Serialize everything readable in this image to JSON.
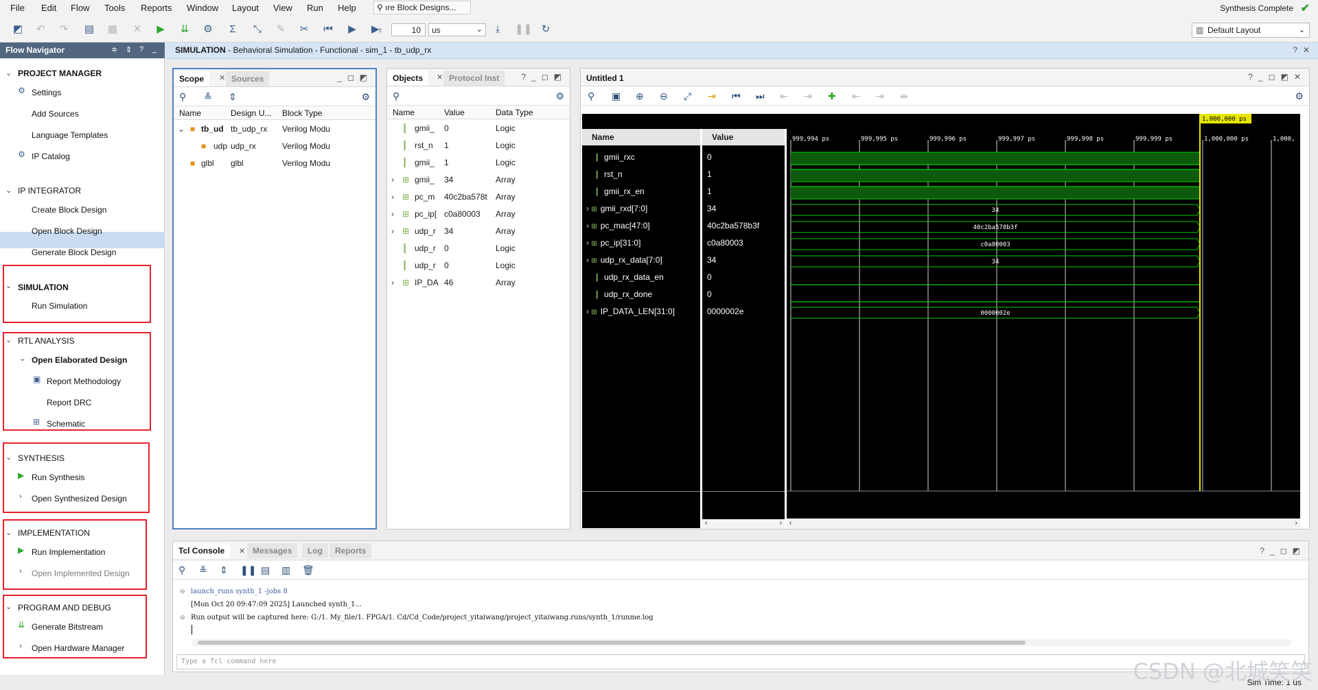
{
  "menu": [
    "File",
    "Edit",
    "Flow",
    "Tools",
    "Reports",
    "Window",
    "Layout",
    "View",
    "Run",
    "Help"
  ],
  "quick_search": "ıre Block Designs...",
  "status": {
    "synthesis": "Synthesis Complete"
  },
  "toolbar": {
    "time_value": "10",
    "time_unit": "us",
    "layout": "Default Layout"
  },
  "flow_nav": {
    "title": "Flow Navigator",
    "sections": {
      "project_manager": "PROJECT MANAGER",
      "ip_integrator": "IP INTEGRATOR",
      "simulation": "SIMULATION",
      "rtl_analysis": "RTL ANALYSIS",
      "synthesis": "SYNTHESIS",
      "implementation": "IMPLEMENTATION",
      "program_debug": "PROGRAM AND DEBUG"
    },
    "items": {
      "settings": "Settings",
      "add_sources": "Add Sources",
      "language_templates": "Language Templates",
      "ip_catalog": "IP Catalog",
      "create_block_design": "Create Block Design",
      "open_block_design": "Open Block Design",
      "generate_block_design": "Generate Block Design",
      "run_simulation": "Run Simulation",
      "open_elaborated_design": "Open Elaborated Design",
      "report_methodology": "Report Methodology",
      "report_drc": "Report DRC",
      "schematic": "Schematic",
      "run_synthesis": "Run Synthesis",
      "open_synthesized_design": "Open Synthesized Design",
      "run_implementation": "Run Implementation",
      "open_implemented_design": "Open Implemented Design",
      "generate_bitstream": "Generate Bitstream",
      "open_hardware_manager": "Open Hardware Manager"
    }
  },
  "sim_header": {
    "prefix": "SIMULATION",
    "rest": " - Behavioral Simulation - Functional - sim_1 - tb_udp_rx"
  },
  "scope_panel": {
    "tabs": [
      "Scope",
      "Sources"
    ],
    "columns": [
      "Name",
      "Design U...",
      "Block Type"
    ],
    "rows": [
      {
        "name": "tb_ud",
        "design": "tb_udp_rx",
        "type": "Verilog Modu"
      },
      {
        "name": "udp",
        "design": "udp_rx",
        "type": "Verilog Modu"
      },
      {
        "name": "glbl",
        "design": "glbl",
        "type": "Verilog Modu"
      }
    ]
  },
  "objects_panel": {
    "tabs": [
      "Objects",
      "Protocol Inst"
    ],
    "columns": [
      "Name",
      "Value",
      "Data Type"
    ],
    "rows": [
      {
        "name": "gmii_",
        "value": "0",
        "type": "Logic"
      },
      {
        "name": "rst_n",
        "value": "1",
        "type": "Logic"
      },
      {
        "name": "gmii_",
        "value": "1",
        "type": "Logic"
      },
      {
        "name": "gmii_",
        "value": "34",
        "type": "Array"
      },
      {
        "name": "pc_m",
        "value": "40c2ba578t",
        "type": "Array"
      },
      {
        "name": "pc_ip[",
        "value": "c0a80003",
        "type": "Array"
      },
      {
        "name": "udp_r",
        "value": "34",
        "type": "Array"
      },
      {
        "name": "udp_r",
        "value": "0",
        "type": "Logic"
      },
      {
        "name": "udp_r",
        "value": "0",
        "type": "Logic"
      },
      {
        "name": "IP_DA",
        "value": "46",
        "type": "Array"
      }
    ]
  },
  "wave": {
    "title": "Untitled 1",
    "name_header": "Name",
    "value_header": "Value",
    "cursor_label": "1,000,000 ps",
    "time_labels": [
      "999,994 ps",
      "999,995 ps",
      "999,996 ps",
      "999,997 ps",
      "999,998 ps",
      "999,999 ps",
      "1,000,000 ps",
      "1,000,"
    ],
    "signals": [
      {
        "name": "gmii_rxc",
        "value": "0",
        "kind": "bit",
        "level": 0,
        "bus_label": ""
      },
      {
        "name": "rst_n",
        "value": "1",
        "kind": "bit",
        "level": 1,
        "bus_label": ""
      },
      {
        "name": "gmii_rx_en",
        "value": "1",
        "kind": "bit",
        "level": 1,
        "bus_label": ""
      },
      {
        "name": "gmii_rxd[7:0]",
        "value": "34",
        "kind": "bus",
        "level": null,
        "bus_label": "34"
      },
      {
        "name": "pc_mac[47:0]",
        "value": "40c2ba578b3f",
        "kind": "bus",
        "level": null,
        "bus_label": "40c2ba578b3f"
      },
      {
        "name": "pc_ip[31:0]",
        "value": "c0a80003",
        "kind": "bus",
        "level": null,
        "bus_label": "c0a80003"
      },
      {
        "name": "udp_rx_data[7:0]",
        "value": "34",
        "kind": "bus",
        "level": null,
        "bus_label": "34"
      },
      {
        "name": "udp_rx_data_en",
        "value": "0",
        "kind": "bit",
        "level": 0,
        "bus_label": ""
      },
      {
        "name": "udp_rx_done",
        "value": "0",
        "kind": "bit",
        "level": 0,
        "bus_label": ""
      },
      {
        "name": "IP_DATA_LEN[31:0]",
        "value": "0000002e",
        "kind": "bus",
        "level": null,
        "bus_label": "0000002e"
      }
    ]
  },
  "console": {
    "tabs": [
      "Tcl Console",
      "Messages",
      "Log",
      "Reports"
    ],
    "lines": [
      "launch_runs synth_1 -jobs 8",
      "[Mon Oct 20 09:47:09 2025] Launched synth_1...",
      "Run output will be captured here: G:/1. My_file/1. FPGA/1. Cd/Cd_Code/project_yitaiwang/project_yitaiwang.runs/synth_1/runme.log"
    ],
    "input_placeholder": "Type a Tcl command here"
  },
  "status_bar": {
    "sim_time": "Sim Time: 1 us"
  },
  "watermark": "CSDN @北城笑笑",
  "colors": {
    "nav_header": "#52677f",
    "sim_header": "#d6e4f6",
    "wave_green": "#00c800",
    "wave_fill": "#0c5a0c",
    "cursor": "#e6e600",
    "highlight_box": "#e8202a"
  }
}
